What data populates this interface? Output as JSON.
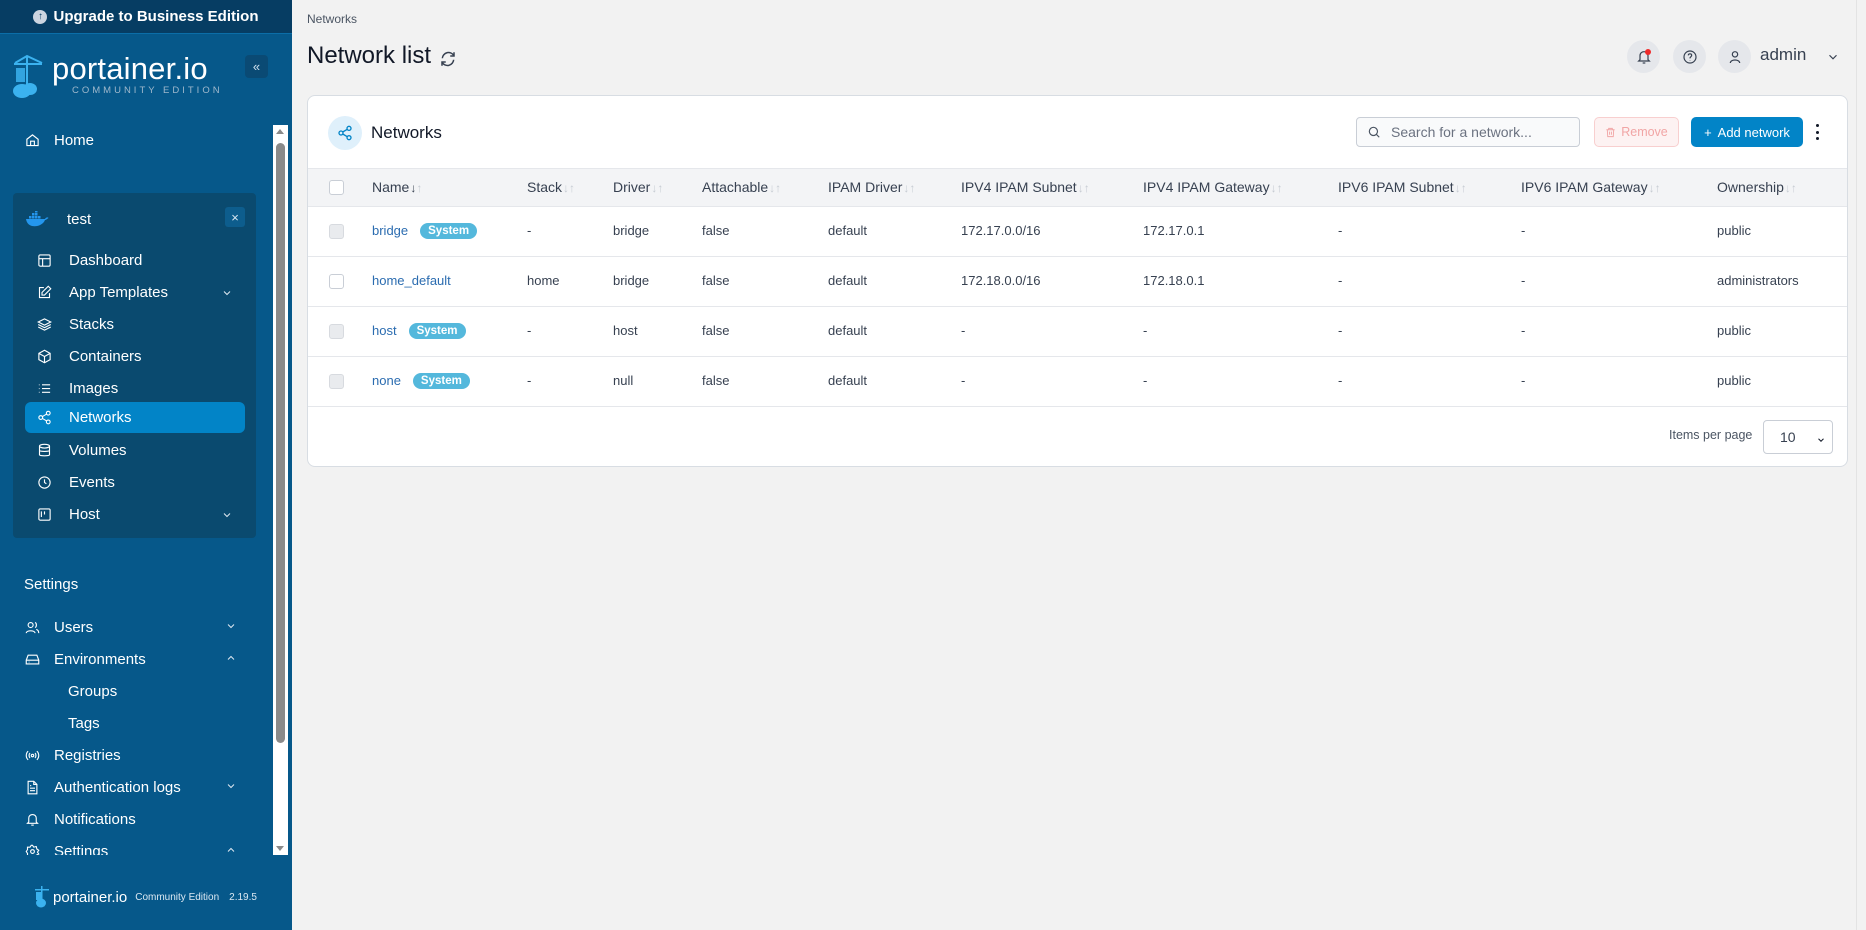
{
  "sidebar": {
    "upgrade_label": "Upgrade to Business Edition",
    "logo_text": "portainer.io",
    "logo_subtitle": "COMMUNITY EDITION",
    "collapse_label": "«",
    "home_label": "Home",
    "environment": {
      "name": "test",
      "close_label": "×",
      "items": [
        {
          "label": "Dashboard",
          "icon": "dashboard-icon"
        },
        {
          "label": "App Templates",
          "icon": "edit-icon",
          "expandable": true
        },
        {
          "label": "Stacks",
          "icon": "layers-icon"
        },
        {
          "label": "Containers",
          "icon": "box-icon"
        },
        {
          "label": "Images",
          "icon": "list-icon"
        },
        {
          "label": "Networks",
          "icon": "share-icon",
          "active": true
        },
        {
          "label": "Volumes",
          "icon": "database-icon"
        },
        {
          "label": "Events",
          "icon": "clock-icon"
        },
        {
          "label": "Host",
          "icon": "trello-icon",
          "expandable": true
        }
      ]
    },
    "settings_section_label": "Settings",
    "settings_items": [
      {
        "label": "Users",
        "icon": "users-icon",
        "chevron": "down"
      },
      {
        "label": "Environments",
        "icon": "hard-drive-icon",
        "chevron": "up"
      },
      {
        "label": "Groups",
        "sub": true
      },
      {
        "label": "Tags",
        "sub": true
      },
      {
        "label": "Registries",
        "icon": "radio-icon"
      },
      {
        "label": "Authentication logs",
        "icon": "file-text-icon",
        "chevron": "down"
      },
      {
        "label": "Notifications",
        "icon": "bell-icon"
      },
      {
        "label": "Settings",
        "icon": "gear-icon",
        "chevron": "up"
      }
    ],
    "footer": {
      "logo_text": "portainer.io",
      "edition": "Community Edition",
      "version": "2.19.5"
    }
  },
  "header": {
    "breadcrumb": "Networks",
    "title": "Network list",
    "user": "admin"
  },
  "networks_panel": {
    "title": "Networks",
    "search_placeholder": "Search for a network...",
    "search_value": "",
    "remove_label": "Remove",
    "add_label": "Add network",
    "columns": [
      "Name",
      "Stack",
      "Driver",
      "Attachable",
      "IPAM Driver",
      "IPV4 IPAM Subnet",
      "IPV4 IPAM Gateway",
      "IPV6 IPAM Subnet",
      "IPV6 IPAM Gateway",
      "Ownership"
    ],
    "sorted_column": "Name",
    "sort_direction": "descending",
    "rows": [
      {
        "name": "bridge",
        "badge": "System",
        "stack": "-",
        "driver": "bridge",
        "attachable": "false",
        "ipam_driver": "default",
        "ipv4_subnet": "172.17.0.0/16",
        "ipv4_gateway": "172.17.0.1",
        "ipv6_subnet": "-",
        "ipv6_gateway": "-",
        "ownership": "public"
      },
      {
        "name": "home_default",
        "badge": null,
        "stack": "home",
        "driver": "bridge",
        "attachable": "false",
        "ipam_driver": "default",
        "ipv4_subnet": "172.18.0.0/16",
        "ipv4_gateway": "172.18.0.1",
        "ipv6_subnet": "-",
        "ipv6_gateway": "-",
        "ownership": "administrators"
      },
      {
        "name": "host",
        "badge": "System",
        "stack": "-",
        "driver": "host",
        "attachable": "false",
        "ipam_driver": "default",
        "ipv4_subnet": "-",
        "ipv4_gateway": "-",
        "ipv6_subnet": "-",
        "ipv6_gateway": "-",
        "ownership": "public"
      },
      {
        "name": "none",
        "badge": "System",
        "stack": "-",
        "driver": "null",
        "attachable": "false",
        "ipam_driver": "default",
        "ipv4_subnet": "-",
        "ipv4_gateway": "-",
        "ipv6_subnet": "-",
        "ipv6_gateway": "-",
        "ownership": "public"
      }
    ],
    "items_per_page_label": "Items per page",
    "items_per_page_value": "10"
  },
  "colors": {
    "sidebar_bg": "#06588a",
    "accent": "#0284c7",
    "badge": "#54b8dc",
    "link": "#2b6cb0"
  }
}
